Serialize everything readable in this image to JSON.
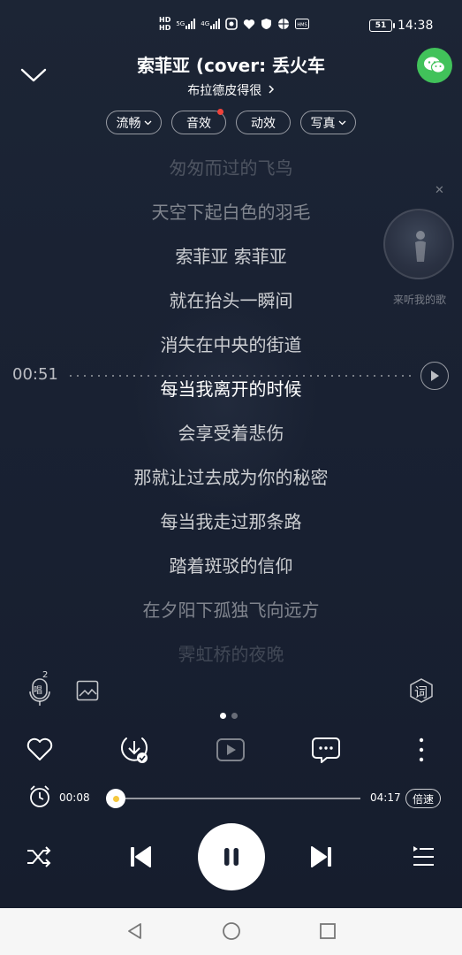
{
  "status_bar": {
    "network_label": "HD",
    "signal1_label": "5G",
    "signal2_label": "4G",
    "battery": "51",
    "time": "14:38"
  },
  "header": {
    "title": "索菲亚 (cover: 丢火车",
    "artist": "布拉德皮得很",
    "chips": [
      {
        "label": "流畅",
        "has_dropdown": true
      },
      {
        "label": "音效",
        "has_dot": true
      },
      {
        "label": "动效"
      },
      {
        "label": "写真",
        "has_dropdown": true
      }
    ]
  },
  "float_card": {
    "label": "来听我的歌"
  },
  "lyrics": {
    "current_time": "00:51",
    "lines": [
      "匆匆而过的飞鸟",
      "天空下起白色的羽毛",
      "索菲亚 索菲亚",
      "就在抬头一瞬间",
      "消失在中央的街道",
      "每当我离开的时候",
      "会享受着悲伤",
      "那就让过去成为你的秘密",
      "每当我走过那条路",
      "踏着斑驳的信仰",
      "在夕阳下孤独飞向远方",
      "霁虹桥的夜晚"
    ],
    "active_index": 5
  },
  "tools": {
    "sing_count": "2",
    "sing_label": "唱",
    "lyrics_label": "词"
  },
  "progress": {
    "elapsed": "00:08",
    "duration": "04:17",
    "fraction": 0.032,
    "speed_label": "倍速"
  },
  "colors": {
    "accent_dot": "#f5c73d",
    "wechat_green": "#41c25a",
    "badge_red": "#f0433b"
  }
}
